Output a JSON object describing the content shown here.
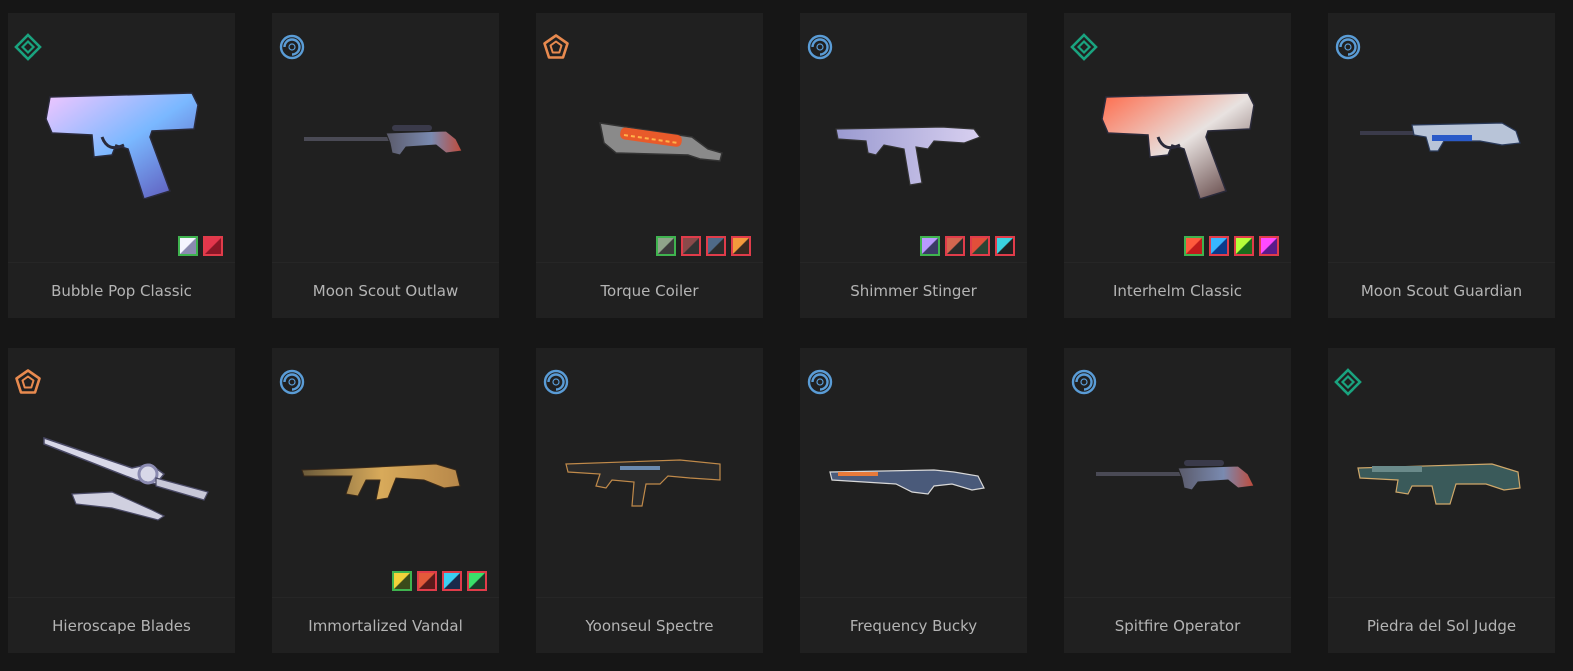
{
  "skins": [
    {
      "name": "Bubble Pop Classic",
      "tier": "premium",
      "tier_icon": "diamond-icon",
      "weapon": "pistol",
      "chromas": [
        {
          "c1": "#f4f4ff",
          "c2": "#8a8ab0",
          "selected": true
        },
        {
          "c1": "#e4364c",
          "c2": "#8a1626",
          "selected": false
        }
      ]
    },
    {
      "name": "Moon Scout Outlaw",
      "tier": "select",
      "tier_icon": "ring-icon",
      "weapon": "sniper",
      "chromas": []
    },
    {
      "name": "Torque Coiler",
      "tier": "exclusive",
      "tier_icon": "pentagon-icon",
      "weapon": "coiler",
      "chromas": [
        {
          "c1": "#8fa48a",
          "c2": "#3b3b3b",
          "selected": true
        },
        {
          "c1": "#8a4a4a",
          "c2": "#333333",
          "selected": false
        },
        {
          "c1": "#4f6a88",
          "c2": "#2c2c2c",
          "selected": false
        },
        {
          "c1": "#f39a3c",
          "c2": "#3a2a20",
          "selected": false
        }
      ]
    },
    {
      "name": "Shimmer Stinger",
      "tier": "select",
      "tier_icon": "ring-icon",
      "weapon": "smg",
      "chromas": [
        {
          "c1": "#b99aff",
          "c2": "#3b3b66",
          "selected": true
        },
        {
          "c1": "#d3664f",
          "c2": "#2a2a2a",
          "selected": false
        },
        {
          "c1": "#e14f3a",
          "c2": "#2b4434",
          "selected": false
        },
        {
          "c1": "#3ad3e0",
          "c2": "#202020",
          "selected": false
        }
      ]
    },
    {
      "name": "Interhelm Classic",
      "tier": "premium",
      "tier_icon": "diamond-icon",
      "weapon": "pistol",
      "chromas": [
        {
          "c1": "#ff5a3c",
          "c2": "#c11b1b",
          "selected": true
        },
        {
          "c1": "#38b6ff",
          "c2": "#0b3a8a",
          "selected": false
        },
        {
          "c1": "#b6ff3a",
          "c2": "#1b6b1b",
          "selected": false
        },
        {
          "c1": "#ff4aff",
          "c2": "#5a1b8a",
          "selected": false
        }
      ]
    },
    {
      "name": "Moon Scout Guardian",
      "tier": "select",
      "tier_icon": "ring-icon",
      "weapon": "rifle",
      "chromas": []
    },
    {
      "name": "Hieroscape Blades",
      "tier": "exclusive",
      "tier_icon": "pentagon-icon",
      "weapon": "blades",
      "chromas": []
    },
    {
      "name": "Immortalized Vandal",
      "tier": "select",
      "tier_icon": "ring-icon",
      "weapon": "vandal",
      "chromas": [
        {
          "c1": "#f2d23a",
          "c2": "#3a4a1a",
          "selected": true
        },
        {
          "c1": "#e35a3a",
          "c2": "#5a1a1a",
          "selected": false
        },
        {
          "c1": "#3ad0f2",
          "c2": "#1a2a4a",
          "selected": false
        },
        {
          "c1": "#3ae06a",
          "c2": "#1a3a2a",
          "selected": false
        }
      ]
    },
    {
      "name": "Yoonseul Spectre",
      "tier": "select",
      "tier_icon": "ring-icon",
      "weapon": "spectre",
      "chromas": []
    },
    {
      "name": "Frequency Bucky",
      "tier": "select",
      "tier_icon": "ring-icon",
      "weapon": "shotgun",
      "chromas": []
    },
    {
      "name": "Spitfire Operator",
      "tier": "select",
      "tier_icon": "ring-icon",
      "weapon": "sniper",
      "chromas": []
    },
    {
      "name": "Piedra del Sol Judge",
      "tier": "premium",
      "tier_icon": "diamond-icon",
      "weapon": "judge",
      "chromas": []
    }
  ],
  "colors": {
    "background": "#161616",
    "card": "#202020",
    "name_text": "#b4b4b4",
    "premium": "#1aa37f",
    "select": "#5a9cd6",
    "exclusive": "#e88a4f",
    "chroma_border": "#e03c4a",
    "chroma_selected_border": "#3fb34f"
  }
}
